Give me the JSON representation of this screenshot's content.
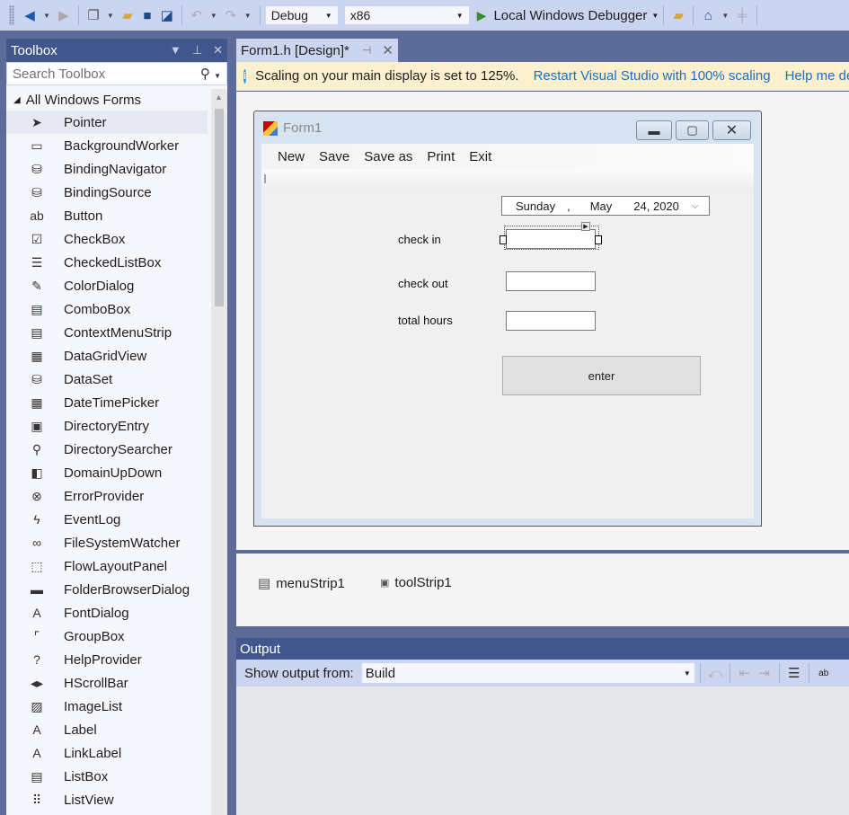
{
  "toolbar": {
    "config": "Debug",
    "platform": "x86",
    "debugger": "Local Windows Debugger",
    "icons": [
      "back-icon",
      "forward-icon",
      "new-project-icon",
      "open-icon",
      "save-icon",
      "save-all-icon",
      "undo-icon",
      "redo-icon",
      "start-icon",
      "find-icon",
      "browser-icon"
    ]
  },
  "toolbox": {
    "title": "Toolbox",
    "search_placeholder": "Search Toolbox",
    "group": "All Windows Forms",
    "items": [
      {
        "label": "Pointer",
        "icon": "pointer-icon",
        "glyph": "➤"
      },
      {
        "label": "BackgroundWorker",
        "icon": "background-worker-icon",
        "glyph": "▭"
      },
      {
        "label": "BindingNavigator",
        "icon": "binding-navigator-icon",
        "glyph": "⛁"
      },
      {
        "label": "BindingSource",
        "icon": "binding-source-icon",
        "glyph": "⛁"
      },
      {
        "label": "Button",
        "icon": "button-icon",
        "glyph": "ab"
      },
      {
        "label": "CheckBox",
        "icon": "checkbox-icon",
        "glyph": "☑"
      },
      {
        "label": "CheckedListBox",
        "icon": "checked-list-box-icon",
        "glyph": "☰"
      },
      {
        "label": "ColorDialog",
        "icon": "color-dialog-icon",
        "glyph": "✎"
      },
      {
        "label": "ComboBox",
        "icon": "combobox-icon",
        "glyph": "▤"
      },
      {
        "label": "ContextMenuStrip",
        "icon": "context-menu-strip-icon",
        "glyph": "▤"
      },
      {
        "label": "DataGridView",
        "icon": "data-grid-view-icon",
        "glyph": "▦"
      },
      {
        "label": "DataSet",
        "icon": "dataset-icon",
        "glyph": "⛁"
      },
      {
        "label": "DateTimePicker",
        "icon": "date-time-picker-icon",
        "glyph": "▦"
      },
      {
        "label": "DirectoryEntry",
        "icon": "directory-entry-icon",
        "glyph": "▣"
      },
      {
        "label": "DirectorySearcher",
        "icon": "directory-searcher-icon",
        "glyph": "⚲"
      },
      {
        "label": "DomainUpDown",
        "icon": "domain-up-down-icon",
        "glyph": "◧"
      },
      {
        "label": "ErrorProvider",
        "icon": "error-provider-icon",
        "glyph": "⊗"
      },
      {
        "label": "EventLog",
        "icon": "event-log-icon",
        "glyph": "ϟ"
      },
      {
        "label": "FileSystemWatcher",
        "icon": "file-system-watcher-icon",
        "glyph": "∞"
      },
      {
        "label": "FlowLayoutPanel",
        "icon": "flow-layout-panel-icon",
        "glyph": "⬚"
      },
      {
        "label": "FolderBrowserDialog",
        "icon": "folder-browser-dialog-icon",
        "glyph": "▬"
      },
      {
        "label": "FontDialog",
        "icon": "font-dialog-icon",
        "glyph": "A"
      },
      {
        "label": "GroupBox",
        "icon": "groupbox-icon",
        "glyph": "⌜"
      },
      {
        "label": "HelpProvider",
        "icon": "help-provider-icon",
        "glyph": "?"
      },
      {
        "label": "HScrollBar",
        "icon": "hscrollbar-icon",
        "glyph": "◂▸"
      },
      {
        "label": "ImageList",
        "icon": "image-list-icon",
        "glyph": "▨"
      },
      {
        "label": "Label",
        "icon": "label-icon",
        "glyph": "A"
      },
      {
        "label": "LinkLabel",
        "icon": "link-label-icon",
        "glyph": "A"
      },
      {
        "label": "ListBox",
        "icon": "listbox-icon",
        "glyph": "▤"
      },
      {
        "label": "ListView",
        "icon": "listview-icon",
        "glyph": "⠿"
      }
    ]
  },
  "document": {
    "tab": "Form1.h [Design]*",
    "info_text": "Scaling on your main display is set to 125%.",
    "info_link1": "Restart Visual Studio with 100% scaling",
    "info_link2": "Help me decide"
  },
  "form": {
    "title": "Form1",
    "menu": [
      "New",
      "Save",
      "Save as",
      "Print",
      "Exit"
    ],
    "date": {
      "day": "Sunday",
      "sep": ",",
      "month": "May",
      "rest": "24, 2020"
    },
    "labels": {
      "check_in": "check in",
      "check_out": "check out",
      "total_hours": "total hours"
    },
    "fields": {
      "check_in": "",
      "check_out": "",
      "total_hours": ""
    },
    "button": "enter"
  },
  "tray": {
    "items": [
      "menuStrip1",
      "toolStrip1"
    ]
  },
  "output": {
    "title": "Output",
    "show_from_label": "Show output from:",
    "source": "Build"
  }
}
